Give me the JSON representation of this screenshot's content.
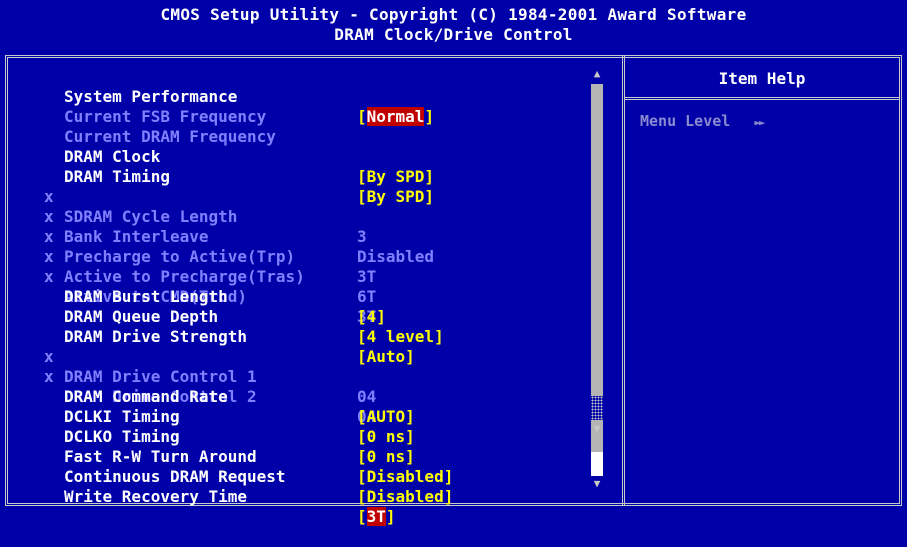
{
  "header": {
    "title": "CMOS Setup Utility - Copyright (C) 1984-2001 Award Software",
    "subtitle": "DRAM Clock/Drive Control"
  },
  "help": {
    "title": "Item Help",
    "menu_level_label": "Menu Level",
    "menu_level_arrows": "►►"
  },
  "colors": {
    "background": "#0000a8",
    "editable_value": "#ffff00",
    "disabled": "#8080ff",
    "highlight": "#c00000"
  },
  "settings": [
    {
      "label": "System Performance",
      "value": "[Normal]",
      "bracket_open": "[",
      "inner": "Normal",
      "bracket_close": "]",
      "state": "selected",
      "marker": ""
    },
    {
      "label": "Current FSB Frequency",
      "value": "",
      "state": "info",
      "marker": ""
    },
    {
      "label": "Current DRAM Frequency",
      "value": "",
      "state": "info",
      "marker": ""
    },
    {
      "label": "DRAM Clock",
      "value": "[By SPD]",
      "state": "editable",
      "marker": ""
    },
    {
      "label": "DRAM Timing",
      "value": "[By SPD]",
      "state": "editable",
      "marker": ""
    },
    {
      "label": "SDRAM Cycle Length",
      "value": "3",
      "state": "disabled",
      "marker": "x"
    },
    {
      "label": "Bank Interleave",
      "value": "Disabled",
      "state": "disabled",
      "marker": "x"
    },
    {
      "label": "Precharge to Active(Trp)",
      "value": "3T",
      "state": "disabled",
      "marker": "x"
    },
    {
      "label": "Active to Precharge(Tras)",
      "value": "6T",
      "state": "disabled",
      "marker": "x"
    },
    {
      "label": "Active to CMD(Trcd)",
      "value": "3T",
      "state": "disabled",
      "marker": "x"
    },
    {
      "label": "DRAM Burst Length",
      "value": "[4]",
      "state": "editable",
      "marker": ""
    },
    {
      "label": "DRAM Queue Depth",
      "value": "[4 level]",
      "state": "editable",
      "marker": ""
    },
    {
      "label": "DRAM Drive Strength",
      "value": "[Auto]",
      "state": "editable",
      "marker": ""
    },
    {
      "label": "DRAM Drive Control 1",
      "value": "04",
      "state": "disabled",
      "marker": "x"
    },
    {
      "label": "DRAM Drive Control 2",
      "value": "04",
      "state": "disabled",
      "marker": "x"
    },
    {
      "label": "DRAM Command Rate",
      "value": "[AUTO]",
      "state": "editable",
      "marker": ""
    },
    {
      "label": "DCLKI Timing",
      "value": "[0 ns]",
      "state": "editable",
      "marker": ""
    },
    {
      "label": "DCLKO Timing",
      "value": "[0 ns]",
      "state": "editable",
      "marker": ""
    },
    {
      "label": "Fast R-W Turn Around",
      "value": "[Disabled]",
      "state": "editable",
      "marker": ""
    },
    {
      "label": "Continuous DRAM Request",
      "value": "[Disabled]",
      "state": "editable",
      "marker": ""
    },
    {
      "label": "Write Recovery Time",
      "value": "[3T]",
      "bracket_open": "[",
      "inner": "3T",
      "bracket_close": "]",
      "state": "cursor",
      "marker": ""
    }
  ],
  "scrollbar": {
    "up_icon": "triangle-up-icon",
    "down_icon": "triangle-down-icon"
  }
}
